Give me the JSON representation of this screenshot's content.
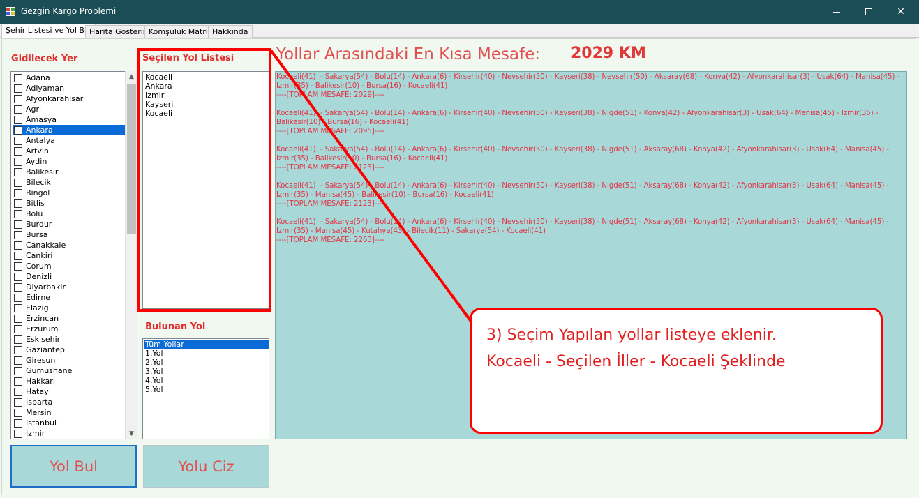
{
  "window": {
    "title": "Gezgin Kargo Problemi",
    "icon": "app-icon",
    "buttons": {
      "minimize": "minimize-icon",
      "maximize": "maximize-icon",
      "close": "✕"
    }
  },
  "tabs": [
    {
      "label": "Şehir Listesi ve Yol Bul",
      "active": true
    },
    {
      "label": "Harita Gosterimi"
    },
    {
      "label": "Komşuluk Matrisi"
    },
    {
      "label": "Hakkında"
    }
  ],
  "city_panel": {
    "heading": "Gidilecek Yer",
    "selected": "Ankara",
    "cities": [
      "Adana",
      "Adiyaman",
      "Afyonkarahisar",
      "Agri",
      "Amasya",
      "Ankara",
      "Antalya",
      "Artvin",
      "Aydin",
      "Balikesir",
      "Bilecik",
      "Bingol",
      "Bitlis",
      "Bolu",
      "Burdur",
      "Bursa",
      "Canakkale",
      "Cankiri",
      "Corum",
      "Denizli",
      "Diyarbakir",
      "Edirne",
      "Elazig",
      "Erzincan",
      "Erzurum",
      "Eskisehir",
      "Gaziantep",
      "Giresun",
      "Gumushane",
      "Hakkari",
      "Hatay",
      "Isparta",
      "Mersin",
      "Istanbul",
      "Izmir"
    ]
  },
  "selected_route_panel": {
    "heading": "Seçilen Yol Listesi",
    "items": [
      "Kocaeli",
      "Ankara",
      "Izmir",
      "Kayseri",
      "Kocaeli"
    ]
  },
  "found_route_panel": {
    "heading": "Bulunan Yol",
    "selected": "Tüm Yollar",
    "items": [
      "Tüm Yollar",
      "1.Yol",
      "2.Yol",
      "3.Yol",
      "4.Yol",
      "5.Yol"
    ]
  },
  "buttons": {
    "find": "Yol Bul",
    "draw": "Yolu Ciz"
  },
  "distance": {
    "label": "Yollar Arasındaki En Kısa Mesafe:",
    "value": "2029 KM"
  },
  "results_lines": [
    "Kocaeli(41)  - Sakarya(54) - Bolu(14) - Ankara(6) - Kirsehir(40) - Nevsehir(50) - Kayseri(38) - Nevsehir(50) - Aksaray(68) - Konya(42) - Afyonkarahisar(3) - Usak(64) - Manisa(45) -",
    "Izmir(35) - Balikesir(10) - Bursa(16) - Kocaeli(41)",
    "----[TOPLAM MESAFE: 2029]----",
    "",
    "Kocaeli(41)  - Sakarya(54) - Bolu(14) - Ankara(6) - Kirsehir(40) - Nevsehir(50) - Kayseri(38) - Nigde(51) - Konya(42) - Afyonkarahisar(3) - Usak(64) - Manisa(45) - Izmir(35) -",
    "Balikesir(10) - Bursa(16) - Kocaeli(41)",
    "----[TOPLAM MESAFE: 2095]----",
    "",
    "Kocaeli(41)  - Sakarya(54) - Bolu(14) - Ankara(6) - Kirsehir(40) - Nevsehir(50) - Kayseri(38) - Nigde(51) - Aksaray(68) - Konya(42) - Afyonkarahisar(3) - Usak(64) - Manisa(45) -",
    "Izmir(35) - Balikesir(10) - Bursa(16) - Kocaeli(41)",
    "----[TOPLAM MESAFE: 2123]----",
    "",
    "Kocaeli(41)  - Sakarya(54) - Bolu(14) - Ankara(6) - Kirsehir(40) - Nevsehir(50) - Kayseri(38) - Nigde(51) - Aksaray(68) - Konya(42) - Afyonkarahisar(3) - Usak(64) - Manisa(45) -",
    "Izmir(35) - Manisa(45) - Balikesir(10) - Bursa(16) - Kocaeli(41)",
    "----[TOPLAM MESAFE: 2123]----",
    "",
    "Kocaeli(41)  - Sakarya(54) - Bolu(14) - Ankara(6) - Kirsehir(40) - Nevsehir(50) - Kayseri(38) - Nigde(51) - Aksaray(68) - Konya(42) - Afyonkarahisar(3) - Usak(64) - Manisa(45) -",
    "Izmir(35) - Manisa(45) - Kutahya(43) - Bilecik(11) - Sakarya(54) - Kocaeli(41)",
    "----[TOPLAM MESAFE: 2263]----"
  ],
  "annotation": {
    "line1": "3) Seçim Yapılan yollar listeye eklenir.",
    "line2": "Kocaeli - Seçilen İller - Kocaeli Şeklinde",
    "color": "#ff0000"
  }
}
